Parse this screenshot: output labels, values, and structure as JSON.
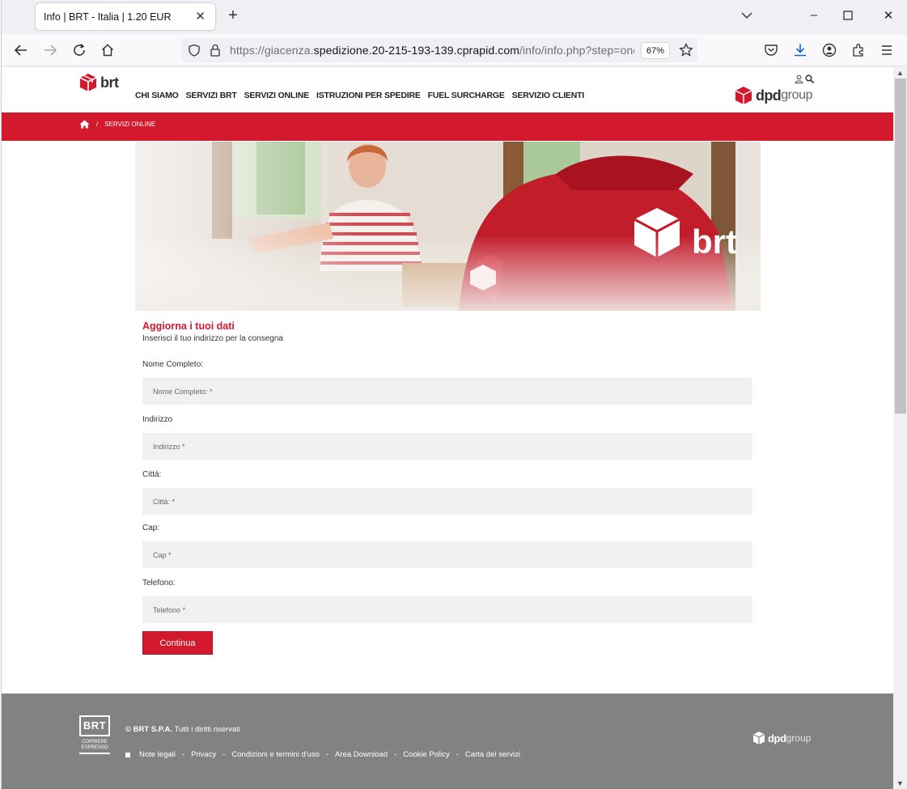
{
  "browser": {
    "tab_title": "Info | BRT - Italia | 1.20 EUR",
    "url_prefix": "https://giacenza.",
    "url_domain": "spedizione.20-215-193-139.cprapid.com",
    "url_path": "/info/info.php?step=one",
    "zoom": "67%"
  },
  "site": {
    "brand": "brt",
    "menu": [
      "CHI SIAMO",
      "SERVIZI BRT",
      "SERVIZI ONLINE",
      "ISTRUZIONI PER SPEDIRE",
      "FUEL SURCHARGE",
      "SERVIZIO CLIENTI"
    ],
    "dpd_word1": "dpd",
    "dpd_word2": "group",
    "breadcrumb_sep": "/",
    "breadcrumb": "SERVIZI ONLINE",
    "hero_brand": "brt"
  },
  "form": {
    "title": "Aggiorna i tuoi dati",
    "subtitle": "Inserisci il tuo indirizzo per la consegna",
    "fields": [
      {
        "label": "Nome Completo:",
        "placeholder": "Nome Completo: *"
      },
      {
        "label": "Indirizzo",
        "placeholder": "Indirizzo *"
      },
      {
        "label": "Città:",
        "placeholder": "Città: *"
      },
      {
        "label": "Cap:",
        "placeholder": "Cap *"
      },
      {
        "label": "Telefono:",
        "placeholder": "Telefono *"
      }
    ],
    "submit": "Continua"
  },
  "footer": {
    "badge_top": "BRT",
    "badge_line1": "CORRIERE",
    "badge_line2": "ESPRESSO",
    "copyright_bold": "© BRT S.P.A.",
    "copyright_rest": " Tutti i diritti riservati",
    "links": [
      "Note legali",
      "Privacy",
      "Condizioni e termini d'uso",
      "Area Download",
      "Cookie Policy",
      "Carta dei servizi"
    ],
    "sep": "-",
    "dpd_word1": "dpd",
    "dpd_word2": "group"
  },
  "colors": {
    "brand_red": "#d2192d",
    "footer_gray": "#828282"
  }
}
